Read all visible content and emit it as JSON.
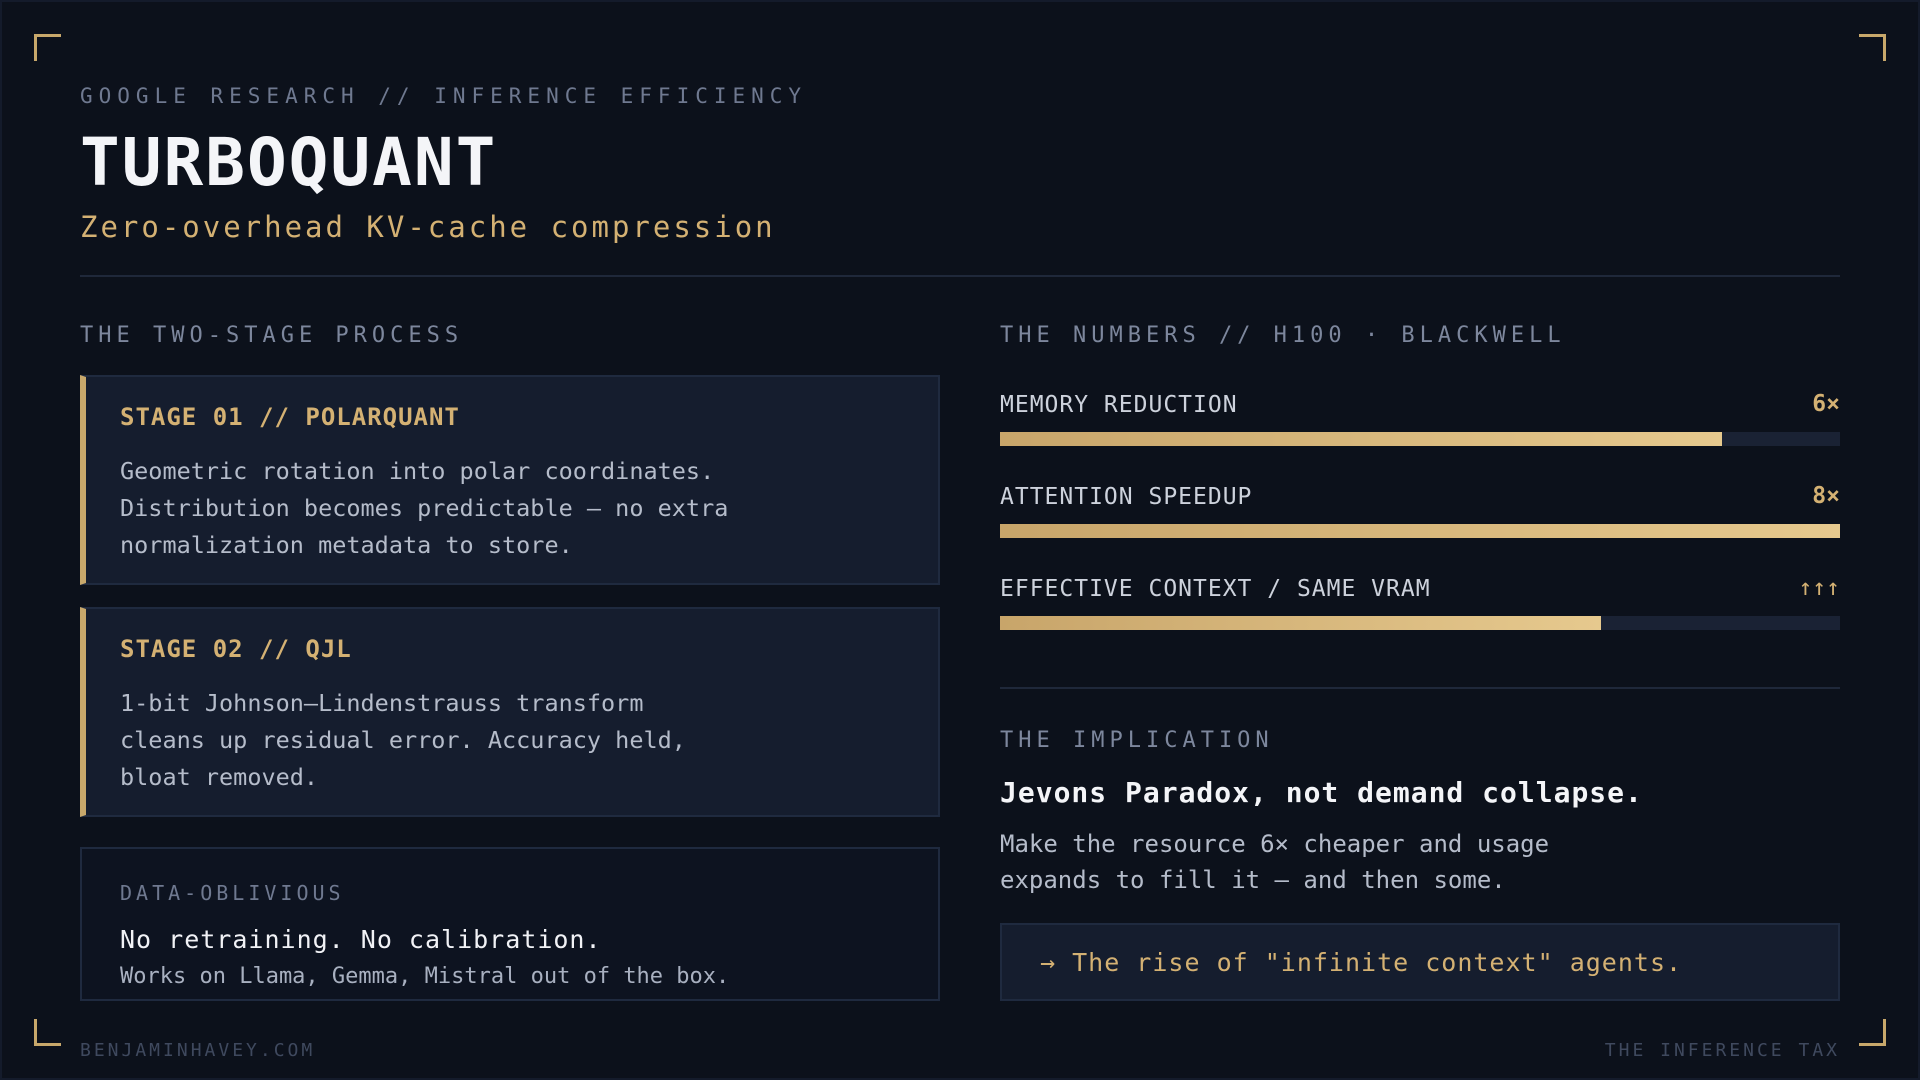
{
  "header": {
    "eyebrow": "GOOGLE RESEARCH // INFERENCE EFFICIENCY",
    "title": "TURBOQUANT",
    "subtitle": "Zero-overhead KV-cache compression"
  },
  "process": {
    "label": "THE TWO-STAGE PROCESS",
    "stages": [
      {
        "title": "STAGE 01 // POLARQUANT",
        "lines": [
          "Geometric rotation into polar coordinates.",
          "Distribution becomes predictable — no extra",
          "normalization metadata to store."
        ]
      },
      {
        "title": "STAGE 02 // QJL",
        "lines": [
          "1-bit Johnson–Lindenstrauss transform",
          "cleans up residual error. Accuracy held,",
          "bloat removed."
        ]
      }
    ],
    "oblivious": {
      "label": "DATA-OBLIVIOUS",
      "headline": "No retraining. No calibration.",
      "detail": "Works on Llama, Gemma, Mistral out of the box."
    }
  },
  "numbers": {
    "label": "THE NUMBERS // H100 · BLACKWELL",
    "metrics": [
      {
        "label": "MEMORY REDUCTION",
        "value": "6×",
        "fill_percent": 86
      },
      {
        "label": "ATTENTION SPEEDUP",
        "value": "8×",
        "fill_percent": 100
      },
      {
        "label": "EFFECTIVE CONTEXT / SAME VRAM",
        "value": "↑↑↑",
        "fill_percent": 71.5
      }
    ]
  },
  "implication": {
    "label": "THE IMPLICATION",
    "headline": "Jevons Paradox, not demand collapse.",
    "lines": [
      "Make the resource 6× cheaper and usage",
      "expands to fill it — and then some."
    ],
    "callout": "→ The rise of \"infinite context\" agents."
  },
  "footer": {
    "left": "BENJAMINHAVEY.COM",
    "right": "THE INFERENCE TAX"
  },
  "colors": {
    "background": "#0c111b",
    "accent": "#d4b173",
    "panel": "#151d2e"
  }
}
